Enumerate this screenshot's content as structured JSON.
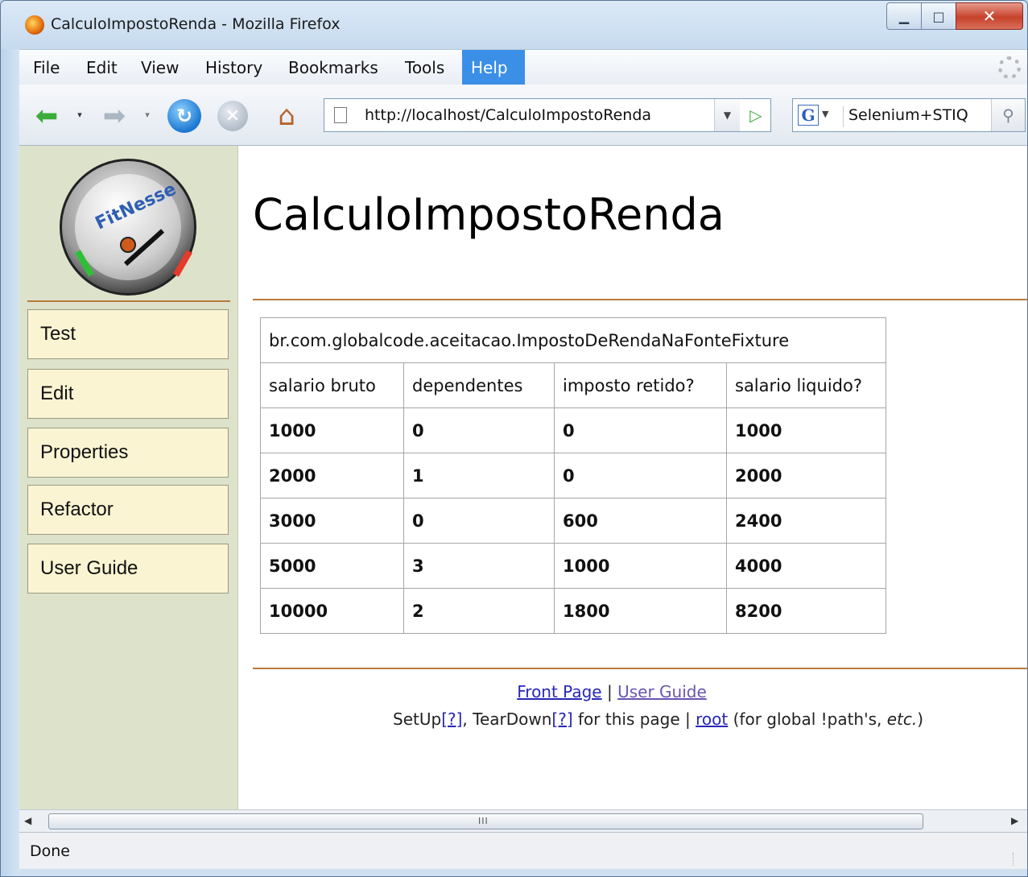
{
  "window": {
    "title": "CalculoImpostoRenda - Mozilla Firefox"
  },
  "menubar": {
    "items": [
      "File",
      "Edit",
      "View",
      "History",
      "Bookmarks",
      "Tools",
      "Help"
    ],
    "active": "Help"
  },
  "toolbar": {
    "url": "http://localhost/CalculoImpostoRenda",
    "search_value": "Selenium+STIQ",
    "search_engine_letter": "G"
  },
  "sidebar": {
    "logo_text": "FitNesse",
    "items": [
      {
        "label": "Test"
      },
      {
        "label": "Edit"
      },
      {
        "label": "Properties"
      },
      {
        "label": "Refactor"
      },
      {
        "label": "User Guide"
      }
    ]
  },
  "page": {
    "title": "CalculoImpostoRenda",
    "fixture": "br.com.globalcode.aceitacao.ImpostoDeRendaNaFonteFixture",
    "headers": [
      "salario bruto",
      "dependentes",
      "imposto retido?",
      "salario liquido?"
    ],
    "rows": [
      [
        "1000",
        "0",
        "0",
        "1000"
      ],
      [
        "2000",
        "1",
        "0",
        "2000"
      ],
      [
        "3000",
        "0",
        "600",
        "2400"
      ],
      [
        "5000",
        "3",
        "1000",
        "4000"
      ],
      [
        "10000",
        "2",
        "1800",
        "8200"
      ]
    ]
  },
  "footer": {
    "front_page": "Front Page",
    "separator": "|",
    "user_guide": "User Guide",
    "setup": "SetUp",
    "help_mark": "[?]",
    "comma_teardown": ", TearDown",
    "for_this_page": " for this page | ",
    "root": "root",
    "global_paths": " (for global !path's, ",
    "etc": "etc.",
    "close_paren": ")"
  },
  "scrollbar": {
    "grip": "III"
  },
  "status": {
    "text": "Done"
  }
}
